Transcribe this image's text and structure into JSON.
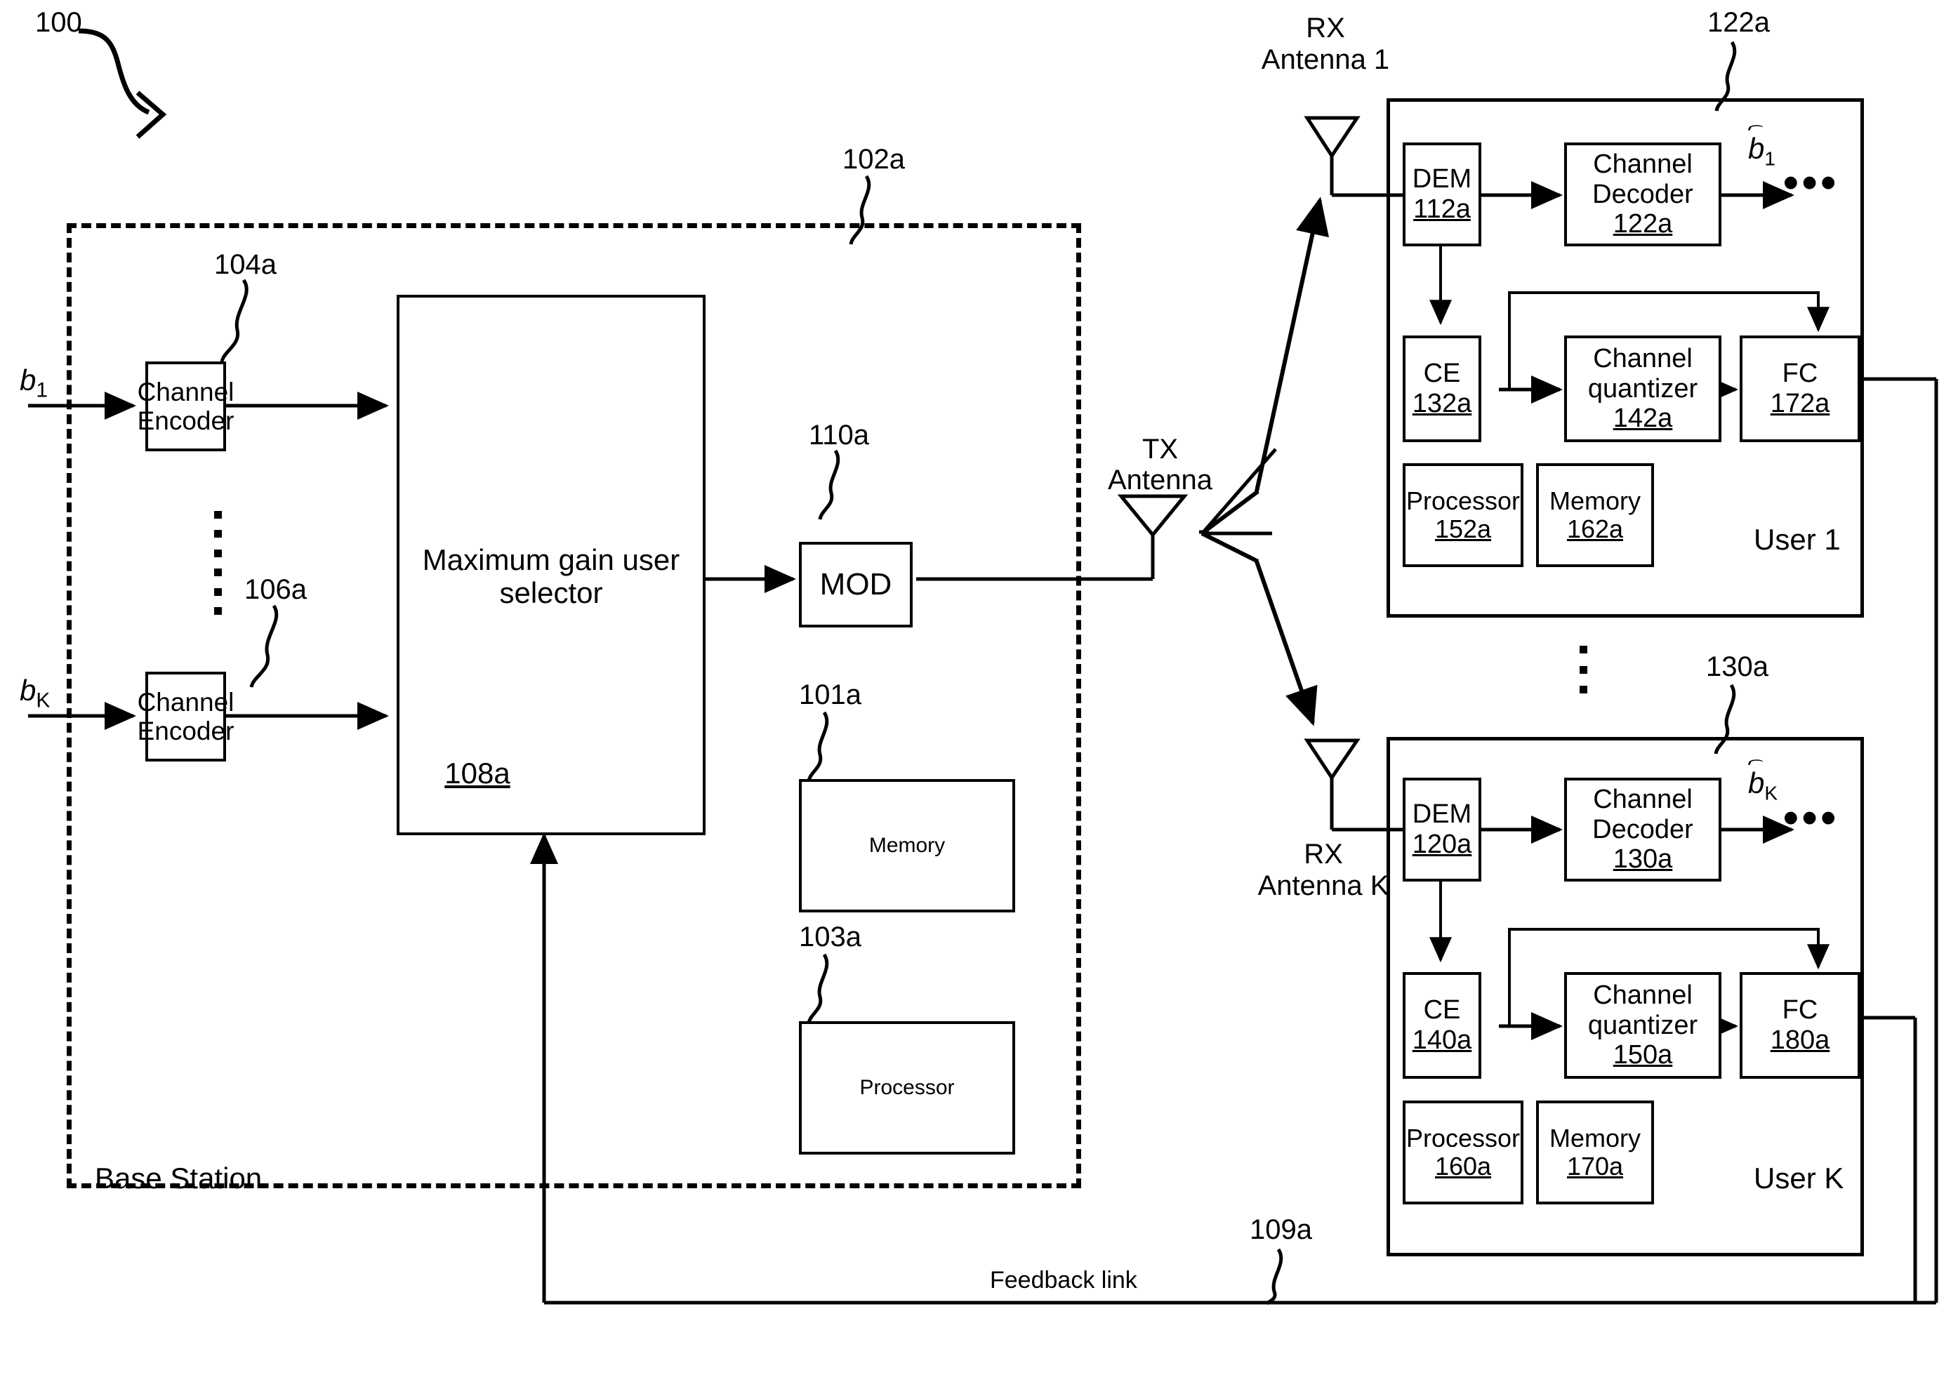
{
  "figure": {
    "figure_ref": "100",
    "base_station": {
      "enclosure_ref": "102a",
      "label": "Base Station",
      "inputs": [
        {
          "symbol": "b",
          "subscript": "1"
        },
        {
          "symbol": "b",
          "subscript": "K"
        }
      ],
      "blocks": [
        {
          "name": "channel-encoder-top",
          "title_line1": "Channel",
          "title_line2": "Encoder",
          "ref": "104a",
          "num": ""
        },
        {
          "name": "channel-encoder-bottom",
          "title_line1": "Channel",
          "title_line2": "Encoder",
          "ref": "106a",
          "num": ""
        },
        {
          "name": "max-gain-user-selector",
          "title_line1": "Maximum gain user",
          "title_line2": "selector",
          "ref": "",
          "num": "108a"
        },
        {
          "name": "modulator",
          "title_line1": "MOD",
          "title_line2": "",
          "ref": "110a",
          "num": ""
        },
        {
          "name": "bs-memory",
          "title_line1": "Memory",
          "title_line2": "",
          "ref": "101a",
          "num": ""
        },
        {
          "name": "bs-processor",
          "title_line1": "Processor",
          "title_line2": "",
          "ref": "103a",
          "num": ""
        }
      ],
      "tx_antenna_label_line1": "TX",
      "tx_antenna_label_line2": "Antenna"
    },
    "users": [
      {
        "name": "user-1",
        "enclosure_ref": "122a",
        "user_label": "User 1",
        "rx_antenna_line1": "RX",
        "rx_antenna_line2": "Antenna 1",
        "output_symbol": "b",
        "output_subscript": "1",
        "ellipsis": "•••",
        "blocks": [
          {
            "name": "demodulator",
            "title_line1": "DEM",
            "title_line2": "",
            "num": "112a"
          },
          {
            "name": "channel-decoder",
            "title_line1": "Channel",
            "title_line2": "Decoder",
            "num": "122a"
          },
          {
            "name": "channel-estimator",
            "title_line1": "CE",
            "title_line2": "",
            "num": "132a"
          },
          {
            "name": "channel-quantizer",
            "title_line1": "Channel",
            "title_line2": "quantizer",
            "num": "142a"
          },
          {
            "name": "feedback-controller",
            "title_line1": "FC",
            "title_line2": "",
            "num": "172a"
          },
          {
            "name": "user-processor",
            "title_line1": "Processor",
            "title_line2": "",
            "num": "152a"
          },
          {
            "name": "user-memory",
            "title_line1": "Memory",
            "title_line2": "",
            "num": "162a"
          }
        ]
      },
      {
        "name": "user-k",
        "enclosure_ref": "130a",
        "user_label": "User K",
        "rx_antenna_line1": "RX",
        "rx_antenna_line2": "Antenna K",
        "output_symbol": "b",
        "output_subscript": "K",
        "ellipsis": "•••",
        "blocks": [
          {
            "name": "demodulator",
            "title_line1": "DEM",
            "title_line2": "",
            "num": "120a"
          },
          {
            "name": "channel-decoder",
            "title_line1": "Channel",
            "title_line2": "Decoder",
            "num": "130a"
          },
          {
            "name": "channel-estimator",
            "title_line1": "CE",
            "title_line2": "",
            "num": "140a"
          },
          {
            "name": "channel-quantizer",
            "title_line1": "Channel",
            "title_line2": "quantizer",
            "num": "150a"
          },
          {
            "name": "feedback-controller",
            "title_line1": "FC",
            "title_line2": "",
            "num": "180a"
          },
          {
            "name": "user-processor",
            "title_line1": "Processor",
            "title_line2": "",
            "num": "160a"
          },
          {
            "name": "user-memory",
            "title_line1": "Memory",
            "title_line2": "",
            "num": "170a"
          }
        ]
      }
    ],
    "feedback": {
      "label": "Feedback link",
      "ref": "109a"
    }
  }
}
